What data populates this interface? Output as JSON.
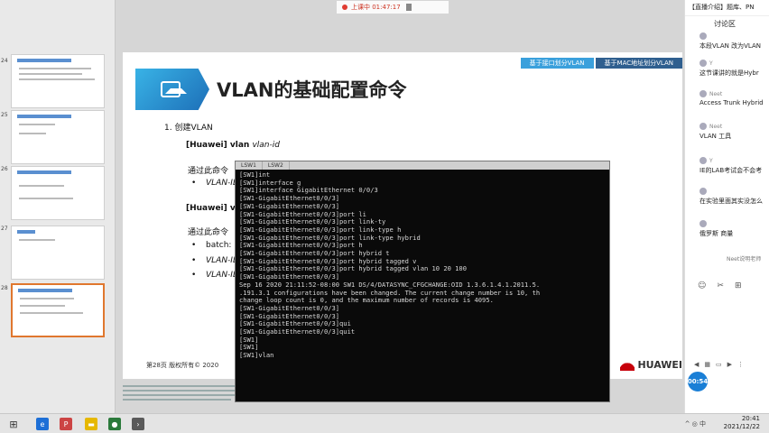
{
  "recording": {
    "status": "上课中 01:47:17"
  },
  "slide": {
    "tabs": [
      "基于接口划分VLAN",
      "基于MAC地址划分VLAN"
    ],
    "title": "VLAN的基础配置命令",
    "item1": "1.   创建VLAN",
    "cmd1_prefix": "[Huawei] vlan ",
    "cmd1_arg": "vlan-id",
    "desc1": "通过此命令",
    "bullet1": "VLAN-ID",
    "cmd2": "[Huawei] vla",
    "desc2": "通过此命令",
    "bullet2": "batch:",
    "bullet3": "VLAN-ID1",
    "bullet4": "VLAN-ID2",
    "footer": "第28页      版权所有© 2020",
    "brand": "HUAWEI"
  },
  "terminal": {
    "tabs": [
      "LSW1",
      "LSW2"
    ],
    "lines": [
      "[SW1]int",
      "[SW1]interface g",
      "[SW1]interface GigabitEthernet 0/0/3",
      "[SW1-GigabitEthernet0/0/3]",
      "[SW1-GigabitEthernet0/0/3]",
      "[SW1-GigabitEthernet0/0/3]port li",
      "[SW1-GigabitEthernet0/0/3]port link-ty",
      "[SW1-GigabitEthernet0/0/3]port link-type h",
      "[SW1-GigabitEthernet0/0/3]port link-type hybrid",
      "[SW1-GigabitEthernet0/0/3]port h",
      "[SW1-GigabitEthernet0/0/3]port hybrid t",
      "[SW1-GigabitEthernet0/0/3]port hybrid tagged v",
      "[SW1-GigabitEthernet0/0/3]port hybrid tagged vlan 10 20 100",
      "[SW1-GigabitEthernet0/0/3]",
      "Sep 16 2020 21:11:52-08:00 SW1 DS/4/DATASYNC_CFGCHANGE:OID 1.3.6.1.4.1.2011.5.",
      ".191.3.1 configurations have been changed. The current change number is 10, th",
      "change loop count is 0, and the maximum number of records is 4095.",
      "[SW1-GigabitEthernet0/0/3]",
      "[SW1-GigabitEthernet0/0/3]",
      "[SW1-GigabitEthernet0/0/3]qui",
      "[SW1-GigabitEthernet0/0/3]quit",
      "[SW1]",
      "[SW1]",
      "[SW1]vlan"
    ]
  },
  "chat": {
    "top": "【直播介绍】题库、PN",
    "header": "讨论区",
    "messages": [
      {
        "user": "",
        "text": "本段VLAN 改为VLAN"
      },
      {
        "user": "Y",
        "text": "这节课讲的就是Hybr"
      },
      {
        "user": "Neet",
        "text": "Access  Trunk Hybrid"
      },
      {
        "user": "Neet",
        "text": "VLAN 工具"
      },
      {
        "user": "Y",
        "text": "IE的LAB考试会不会考"
      },
      {
        "user": "",
        "text": "在实验里面其实没怎么"
      },
      {
        "user": "",
        "text": "俄罗斯 商量"
      }
    ],
    "system": "Neet说明老师",
    "timer": "00:54"
  },
  "taskbar": {
    "time": "20:41",
    "date": "2021/12/22",
    "tray": "^ ◎ 中"
  }
}
